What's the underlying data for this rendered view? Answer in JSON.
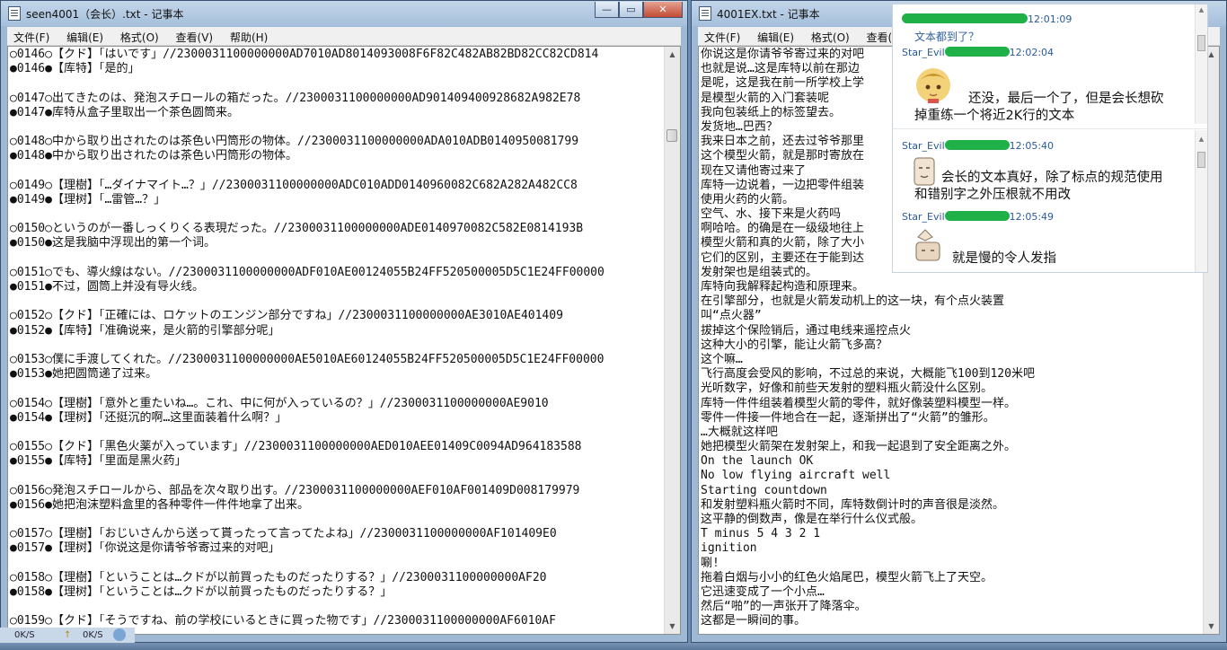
{
  "left_window": {
    "title": "seen4001（会长）.txt - 记事本",
    "controls": {
      "minimize": "—",
      "maximize": "▭",
      "close": "✕"
    },
    "menu": [
      "文件(F)",
      "编辑(E)",
      "格式(O)",
      "查看(V)",
      "帮助(H)"
    ],
    "lines": [
      "○0146○【クド】「はいです」//2300031100000000AD7010AD8014093008F6F82C482AB82BD82CC82CD814",
      "●0146●【库特】「是的」",
      "",
      "○0147○出てきたのは、発泡スチロールの箱だった。//2300031100000000AD901409400928682A982E78",
      "●0147●库特从盒子里取出一个茶色圆筒来。",
      "",
      "○0148○中から取り出されたのは茶色い円筒形の物体。//2300031100000000ADA010ADB0140950081799",
      "●0148●中から取り出されたのは茶色い円筒形の物体。",
      "",
      "○0149○【理樹】「…ダイナマイト…？」//2300031100000000ADC010ADD0140960082C682A282A482CC8",
      "●0149●【理树】「…雷管…？」",
      "",
      "○0150○というのが一番しっくりくる表現だった。//2300031100000000ADE0140970082C582E0814193B",
      "●0150●这是我脑中浮现出的第一个词。",
      "",
      "○0151○でも、導火線はない。//2300031100000000ADF010AE00124055B24FF520500005D5C1E24FF00000",
      "●0151●不过，圆筒上并没有导火线。",
      "",
      "○0152○【クド】「正確には、ロケットのエンジン部分ですね」//2300031100000000AE3010AE401409",
      "●0152●【库特】「准确说来，是火箭的引擎部分呢」",
      "",
      "○0153○僕に手渡してくれた。//2300031100000000AE5010AE60124055B24FF520500005D5C1E24FF00000",
      "●0153●她把圆筒递了过来。",
      "",
      "○0154○【理樹】「意外と重たいね…。これ、中に何が入っているの？」//2300031100000000AE9010",
      "●0154●【理树】「还挺沉的啊…这里面装着什么啊？」",
      "",
      "○0155○【クド】「黒色火薬が入っています」//2300031100000000AED010AEE01409C0094AD964183588",
      "●0155●【库特】「里面是黑火药」",
      "",
      "○0156○発泡スチロールから、部品を次々取り出す。//2300031100000000AEF010AF001409D008179979",
      "●0156●她把泡沫塑料盒里的各种零件一件件地拿了出来。",
      "",
      "○0157○【理樹】「おじいさんから送って貰ったって言ってたよね」//2300031100000000AF101409E0",
      "●0157●【理树】「你说这是你请爷爷寄过来的对吧」",
      "",
      "○0158○【理樹】「ということは…クドが以前買ったものだったりする？」//2300031100000000AF20",
      "●0158●【理树】「ということは…クドが以前買ったものだったりする？」",
      "",
      "○0159○【クド】「そうですね、前の学校にいるときに買った物です」//2300031100000000AF6010AF"
    ]
  },
  "right_window": {
    "title": "4001EX.txt - 记事本",
    "menu": [
      "文件(F)",
      "编辑(E)",
      "格式(O)",
      "查看(V)"
    ],
    "lines": [
      "你说这是你请爷爷寄过来的对吧",
      "也就是说…这是库特以前在那边",
      "是呢，这是我在前一所学校上学",
      "是模型火箭的入门套装呢",
      "我向包装纸上的标签望去。",
      "发货地…巴西？",
      "我来日本之前，还去过爷爷那里",
      "这个模型火箭，就是那时寄放在",
      "现在又请他寄过来了",
      "库特一边说着，一边把零件组装",
      "使用火药的火箭。",
      "空气、水、接下来是火药吗",
      "啊哈哈。的确是在一级级地往上",
      "模型火箭和真的火箭，除了大小",
      "它们的区别，主要还在于能到达",
      "发射架也是组装式的。",
      "库特向我解释起构造和原理来。",
      "在引擎部分，也就是火箭发动机上的这一块，有个点火装置",
      "叫“点火器”",
      "拔掉这个保险销后，通过电线来遥控点火",
      "这种大小的引擎，能让火箭飞多高？",
      "这个嘛…",
      "飞行高度会受风的影响，不过总的来说，大概能飞100到120米吧",
      "光听数字，好像和前些天发射的塑料瓶火箭没什么区别。",
      "库特一件件组装着模型火箭的零件，就好像装塑料模型一样。",
      "零件一件接一件地合在一起，逐渐拼出了“火箭”的雏形。",
      "…大概就这样吧",
      "她把模型火箭架在发射架上，和我一起退到了安全距离之外。",
      "On the launch OK",
      "No low flying aircraft well",
      "Starting countdown",
      "和发射塑料瓶火箭时不同，库特数倒计时的声音很是淡然。",
      "这平静的倒数声，像是在举行什么仪式般。",
      "T minus 5 4 3 2 1",
      "ignition",
      "唰!",
      "拖着白烟与小小的红色火焰尾巴，模型火箭飞上了天空。",
      "它迅速变成了一个小点…",
      "然后“啪”的一声张开了降落伞。",
      "这都是一瞬间的事。"
    ]
  },
  "chat": {
    "messages": [
      {
        "sender": "",
        "time": "12:01:09",
        "text": "文本都到了？"
      },
      {
        "sender": "Star_Evil",
        "time": "12:02:04",
        "text": "还没，最后一个了，但是会长想砍掉重练一个将近2K行的文本"
      },
      {
        "sender": "Star_Evil",
        "time": "12:05:40",
        "text": "会长的文本真好，除了标点的规范使用和错别字之外压根就不用改"
      },
      {
        "sender": "Star_Evil",
        "time": "12:05:49",
        "text": "就是慢的令人发指"
      }
    ]
  },
  "status": {
    "up_speed": "0K/S",
    "down_speed": "0K/S"
  },
  "colors": {
    "chat_sender": "#2a5a9c",
    "redaction": "#1fb148",
    "titlebar": "#b3c9e1"
  }
}
